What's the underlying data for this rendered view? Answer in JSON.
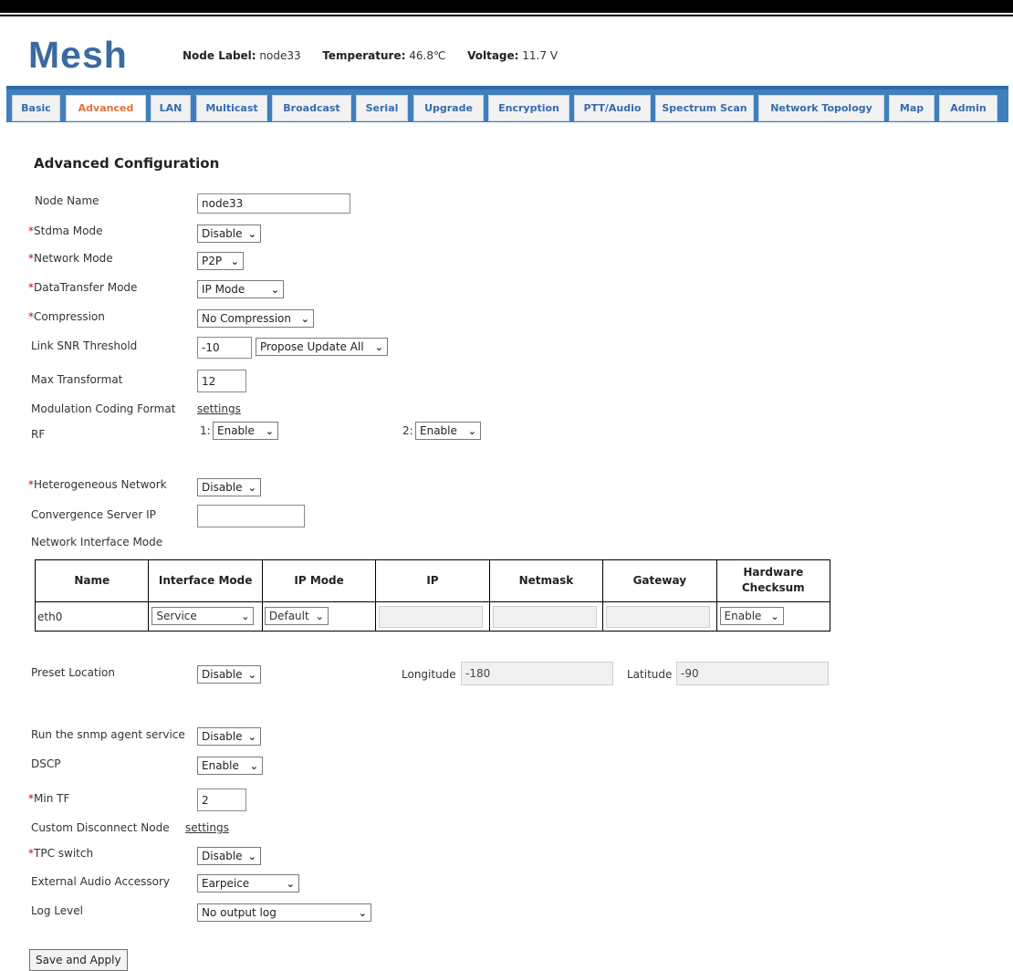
{
  "header": {
    "logo": "Mesh",
    "node_label_key": "Node Label:",
    "node_label_value": "node33",
    "temperature_key": "Temperature:",
    "temperature_value": "46.8℃",
    "voltage_key": "Voltage:",
    "voltage_value": "11.7 V"
  },
  "tabs": [
    "Basic",
    "Advanced",
    "LAN",
    "Multicast",
    "Broadcast",
    "Serial",
    "Upgrade",
    "Encryption",
    "PTT/Audio",
    "Spectrum Scan",
    "Network Topology",
    "Map",
    "Admin"
  ],
  "active_tab": "Advanced",
  "page_title": "Advanced Configuration",
  "form": {
    "node_name": {
      "label": "Node Name",
      "value": "node33"
    },
    "stdma_mode": {
      "star": "*",
      "label": "Stdma Mode",
      "value": "Disable"
    },
    "network_mode": {
      "star": "*",
      "label": "Network Mode",
      "value": "P2P"
    },
    "datatransfer_mode": {
      "star": "*",
      "label": "DataTransfer Mode",
      "value": "IP Mode"
    },
    "compression": {
      "star": "*",
      "label": "Compression",
      "value": "No Compression"
    },
    "link_snr": {
      "label": "Link SNR Threshold",
      "value": "-10",
      "select": "Propose Update All"
    },
    "max_transformat": {
      "label": "Max Transformat",
      "value": "12"
    },
    "mcf": {
      "label": "Modulation Coding Format",
      "link": "settings"
    },
    "rf": {
      "label": "RF",
      "rf1_prefix": "1:",
      "rf1_value": "Enable",
      "rf2_prefix": "2:",
      "rf2_value": "Enable"
    },
    "hetero": {
      "star": "*",
      "label": "Heterogeneous Network",
      "value": "Disable"
    },
    "conv_ip": {
      "label": "Convergence Server IP",
      "value": ""
    },
    "net_if_mode": {
      "label": "Network Interface Mode"
    },
    "preset_location": {
      "label": "Preset Location",
      "value": "Disable",
      "longitude_label": "Longitude",
      "longitude": "-180",
      "latitude_label": "Latitude",
      "latitude": "-90"
    },
    "snmp": {
      "label": "Run the snmp agent service",
      "value": "Disable"
    },
    "dscp": {
      "label": "DSCP",
      "value": "Enable"
    },
    "min_tf": {
      "star": "*",
      "label": "Min TF",
      "value": "2"
    },
    "custom_disconnect": {
      "label": "Custom Disconnect Node",
      "link": "settings"
    },
    "tpc": {
      "star": "*",
      "label": "TPC switch",
      "value": "Disable"
    },
    "ext_audio": {
      "label": "External Audio Accessory",
      "value": "Earpeice"
    },
    "log_level": {
      "label": "Log Level",
      "value": "No output log"
    }
  },
  "iface_table": {
    "headers": [
      "Name",
      "Interface Mode",
      "IP Mode",
      "IP",
      "Netmask",
      "Gateway",
      "Hardware\nChecksum"
    ],
    "rows": [
      {
        "name": "eth0",
        "interface_mode": "Service",
        "ip_mode": "Default",
        "ip": "",
        "netmask": "",
        "gateway": "",
        "checksum": "Enable"
      }
    ]
  },
  "save_button": "Save and Apply",
  "icons": {
    "dropdown": "chevron-down-icon"
  },
  "colors": {
    "logo": "#3b6aa0",
    "tab_bar": "#3f7fbe",
    "tab_text": "#356bb0",
    "active_tab_text": "#e2703a",
    "required_star": "#cc0000"
  }
}
